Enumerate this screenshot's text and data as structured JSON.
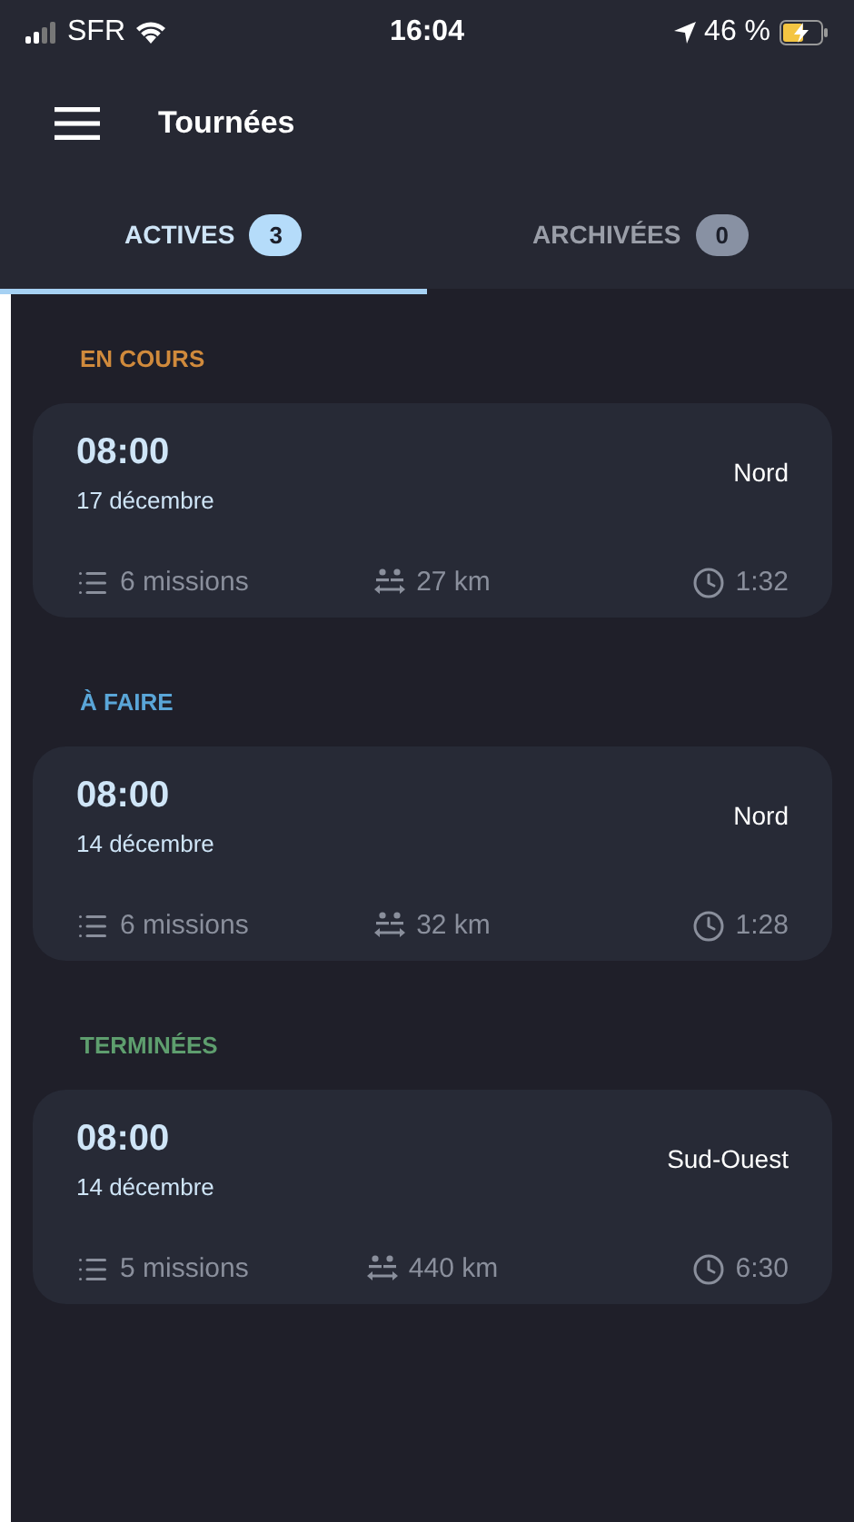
{
  "status_bar": {
    "carrier": "SFR",
    "time": "16:04",
    "battery": "46 %"
  },
  "header": {
    "title": "Tournées"
  },
  "tabs": [
    {
      "label": "ACTIVES",
      "count": "3",
      "selected": true
    },
    {
      "label": "ARCHIVÉES",
      "count": "0",
      "selected": false
    }
  ],
  "sections": [
    {
      "title": "EN COURS",
      "color": "#d08a3c",
      "tours": [
        {
          "time": "08:00",
          "date": "17 décembre",
          "zone": "Nord",
          "missions": "6 missions",
          "distance": "27 km",
          "duration": "1:32"
        }
      ]
    },
    {
      "title": "À FAIRE",
      "color": "#5aa6d8",
      "tours": [
        {
          "time": "08:00",
          "date": "14 décembre",
          "zone": "Nord",
          "missions": "6 missions",
          "distance": "32 km",
          "duration": "1:28"
        }
      ]
    },
    {
      "title": "TERMINÉES",
      "color": "#5e9e6e",
      "tours": [
        {
          "time": "08:00",
          "date": "14 décembre",
          "zone": "Sud-Ouest",
          "missions": "5 missions",
          "distance": "440 km",
          "duration": "6:30"
        }
      ]
    }
  ]
}
